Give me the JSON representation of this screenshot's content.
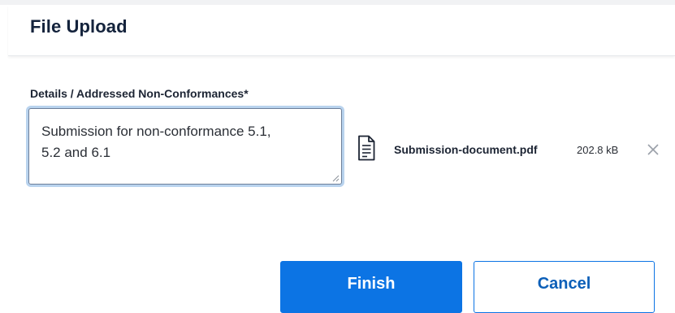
{
  "dialog": {
    "title": "File Upload"
  },
  "details_field": {
    "label": "Details / Addressed Non-Conformances*",
    "value": "Submission for non-conformance 5.1,\n5.2 and 6.1"
  },
  "attachment": {
    "icon": "document-icon",
    "file_name": "Submission-document.pdf",
    "file_size": "202.8 kB",
    "remove_icon": "close-icon"
  },
  "actions": {
    "finish_label": "Finish",
    "cancel_label": "Cancel"
  },
  "colors": {
    "primary": "#0c74e4",
    "title_text": "#14233c",
    "focus_ring": "#b9d3ee"
  }
}
